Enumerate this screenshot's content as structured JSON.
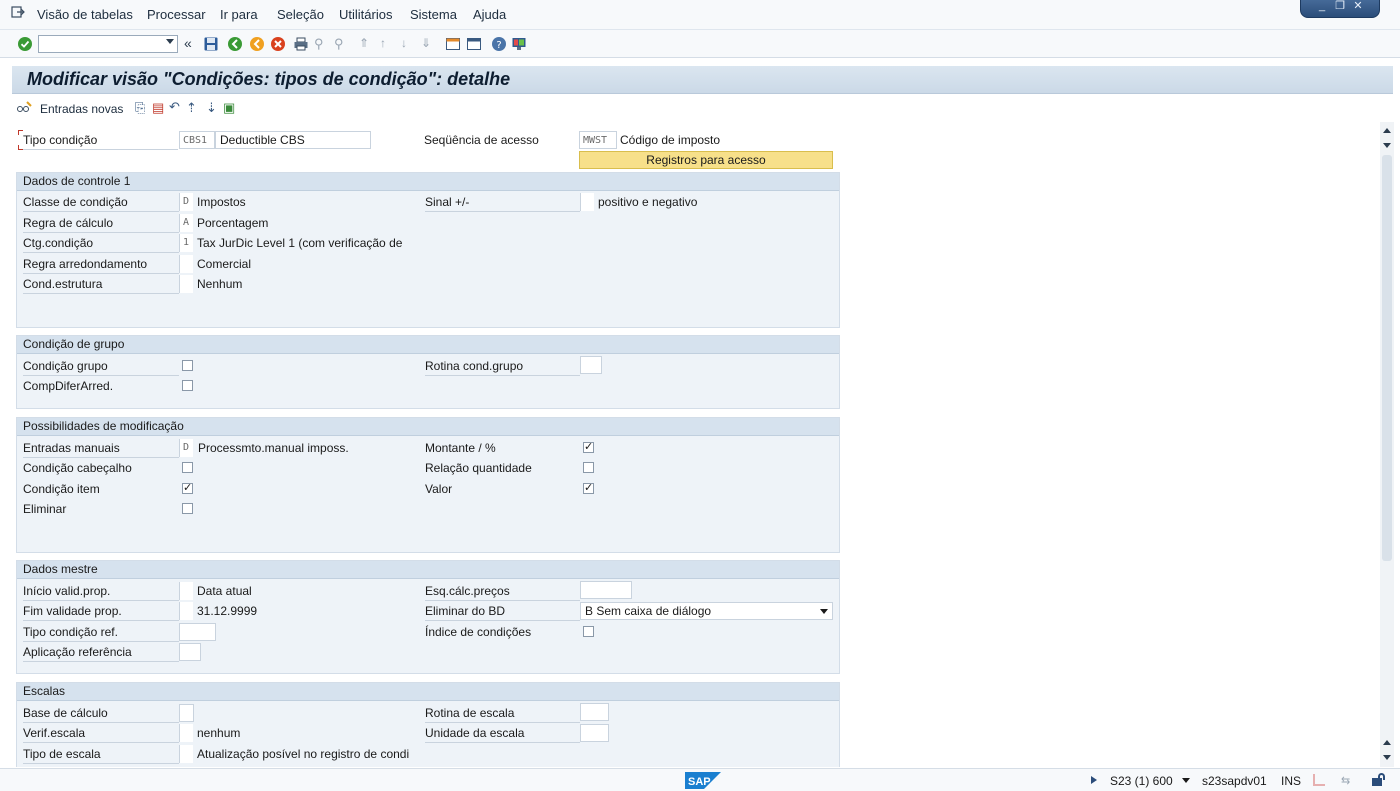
{
  "menu": {
    "items": [
      "Visão de tabelas",
      "Processar",
      "Ir para",
      "Seleção",
      "Utilitários",
      "Sistema",
      "Ajuda"
    ]
  },
  "title": "Modificar visão \"Condições: tipos de condição\": detalhe",
  "app_toolbar": {
    "new_entries_label": "Entradas novas"
  },
  "header": {
    "tipo_condicao_label": "Tipo condição",
    "tipo_condicao_code": "CBS1",
    "tipo_condicao_desc": "Deductible CBS",
    "sequencia_label": "Seqüência de acesso",
    "sequencia_code": "MWST",
    "sequencia_desc": "Código de imposto",
    "registros_button": "Registros para acesso"
  },
  "groups": {
    "controle1": {
      "title": "Dados de controle 1",
      "classe_label": "Classe de condição",
      "classe_code": "D",
      "classe_desc": "Impostos",
      "regra_calc_label": "Regra de cálculo",
      "regra_calc_code": "A",
      "regra_calc_desc": "Porcentagem",
      "ctg_label": "Ctg.condição",
      "ctg_code": "1",
      "ctg_desc": "Tax JurDic Level 1 (com verificação de",
      "arred_label": "Regra arredondamento",
      "arred_desc": "Comercial",
      "estrut_label": "Cond.estrutura",
      "estrut_desc": "Nenhum",
      "sinal_label": "Sinal +/-",
      "sinal_desc": "positivo e negativo"
    },
    "grupo": {
      "title": "Condição de grupo",
      "cond_grupo_label": "Condição grupo",
      "compdifer_label": "CompDiferArred.",
      "rotina_label": "Rotina cond.grupo"
    },
    "modif": {
      "title": "Possibilidades de modificação",
      "manuais_label": "Entradas manuais",
      "manuais_code": "D",
      "manuais_desc": "Processmto.manual imposs.",
      "cabecalho_label": "Condição cabeçalho",
      "item_label": "Condição item",
      "eliminar_label": "Eliminar",
      "montante_label": "Montante / %",
      "relacao_label": "Relação quantidade",
      "valor_label": "Valor"
    },
    "mestre": {
      "title": "Dados mestre",
      "inicio_label": "Início valid.prop.",
      "inicio_desc": "Data atual",
      "fim_label": "Fim validade prop.",
      "fim_value": "31.12.9999",
      "ref_label": "Tipo condição ref.",
      "aplic_label": "Aplicação referência",
      "esq_label": "Esq.cálc.preços",
      "elim_bd_label": "Eliminar do BD",
      "elim_bd_value": "B Sem caixa de diálogo",
      "indice_label": "Índice de condições"
    },
    "escalas": {
      "title": "Escalas",
      "base_label": "Base de cálculo",
      "verif_label": "Verif.escala",
      "verif_desc": "nenhum",
      "tipo_label": "Tipo de escala",
      "tipo_desc": "Atualização posível no registro de condi",
      "rotina_label": "Rotina de escala",
      "unidade_label": "Unidade da escala"
    }
  },
  "checkboxes": {
    "cond_grupo": false,
    "compdifer": false,
    "cabecalho": false,
    "item": true,
    "eliminar": false,
    "montante": true,
    "relacao": false,
    "valor": true,
    "indice": false
  },
  "status": {
    "system": "S23 (1) 600",
    "server": "s23sapdv01",
    "mode": "INS",
    "logo": "SAP"
  }
}
